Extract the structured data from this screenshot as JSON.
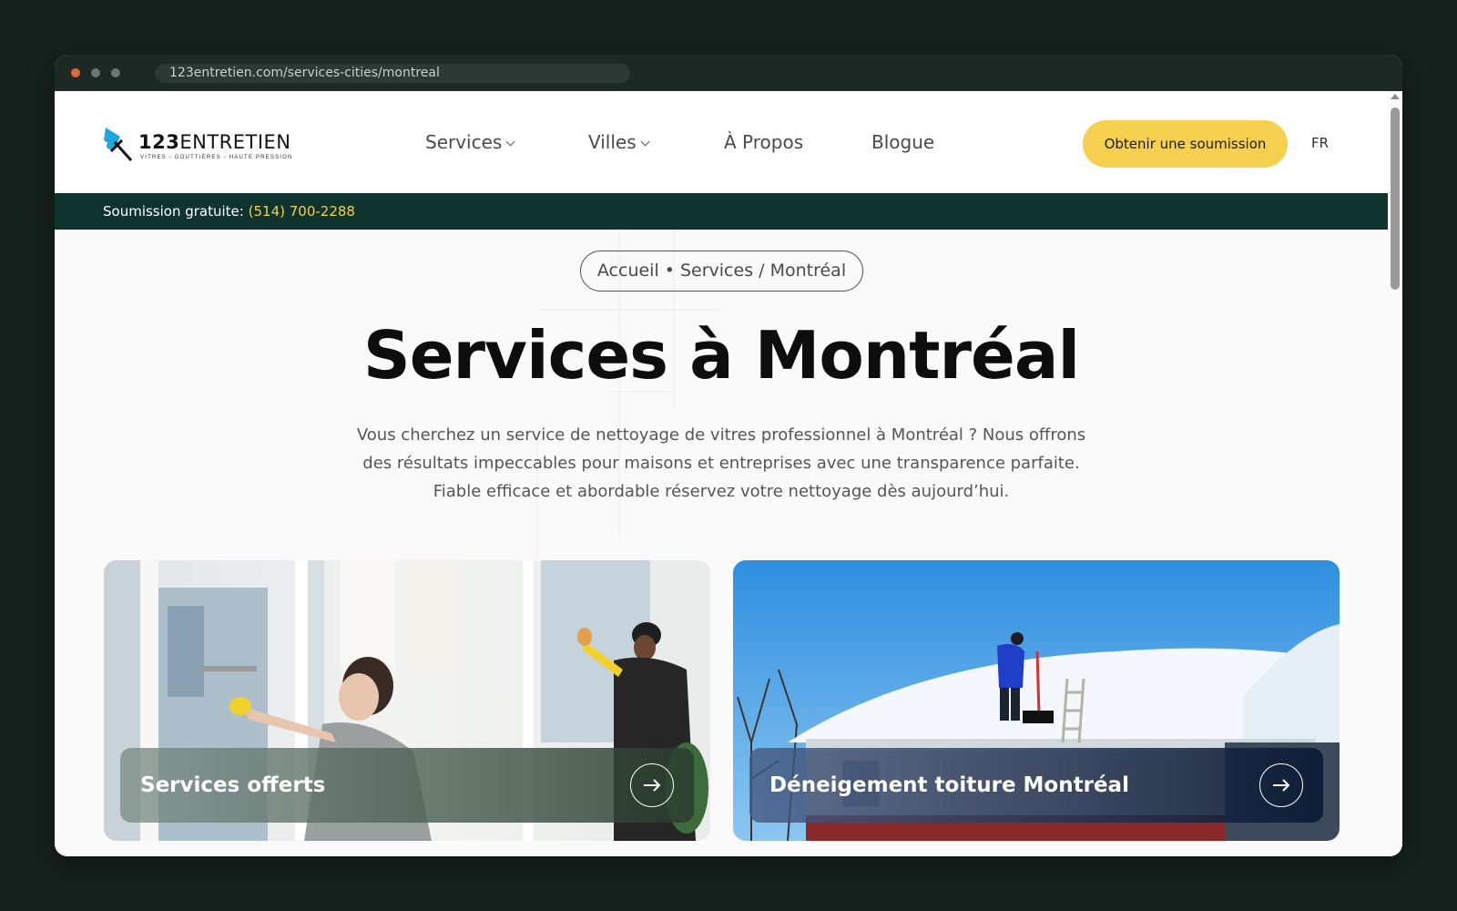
{
  "browser": {
    "url": "123entretien.com/services-cities/montreal"
  },
  "header": {
    "logo_text_bold": "123",
    "logo_text_rest": "ENTRETIEN",
    "logo_tagline": "VITRES - GOUTTIÈRES - HAUTE PRESSION",
    "nav": [
      {
        "label": "Services",
        "dropdown": true
      },
      {
        "label": "Villes",
        "dropdown": true
      },
      {
        "label": "À Propos",
        "dropdown": false
      },
      {
        "label": "Blogue",
        "dropdown": false
      }
    ],
    "cta_label": "Obtenir une soumission",
    "lang": "FR"
  },
  "topbar": {
    "prefix": "Soumission gratuite:",
    "phone": "(514) 700-2288"
  },
  "breadcrumb": {
    "home": "Accueil",
    "section": "Services",
    "slash": "/",
    "current": "Montréal"
  },
  "hero": {
    "title": "Services à Montréal",
    "subtitle": "Vous cherchez un service de nettoyage de vitres professionnel à Montréal ? Nous offrons des résultats impeccables pour maisons et entreprises avec une transparence parfaite. Fiable efficace et abordable réservez votre nettoyage dès aujourd’hui."
  },
  "cards": [
    {
      "label": "Services offerts",
      "image": "window-cleaning-photo"
    },
    {
      "label": "Déneigement toiture Montréal",
      "image": "roof-snow-removal-photo"
    }
  ],
  "colors": {
    "accent": "#f5d04e",
    "dark_green": "#0f3430",
    "page_bg": "#16211d"
  }
}
